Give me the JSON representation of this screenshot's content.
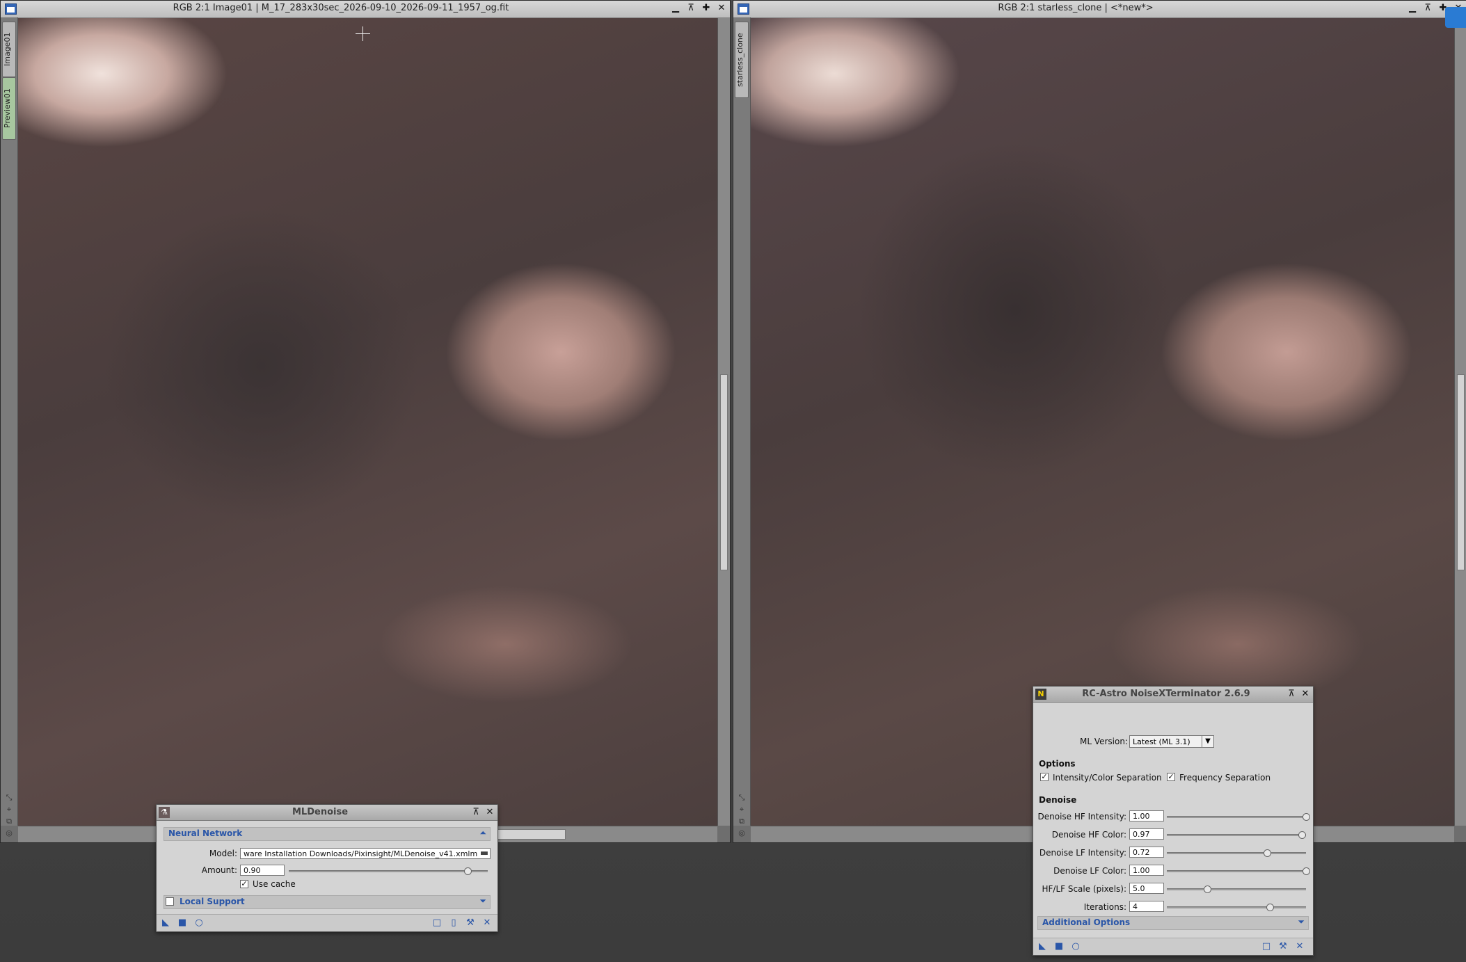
{
  "left_window": {
    "title": "RGB 2:1 Image01 | M_17_283x30sec_2026-09-10_2026-09-11_1957_og.fit",
    "tabs": [
      "Image01",
      "Preview01"
    ]
  },
  "right_window": {
    "title": "RGB 2:1 starless_clone | <*new*>",
    "tabs": [
      "starless_clone"
    ]
  },
  "mldenoise": {
    "title": "MLDenoise",
    "section_neural": "Neural Network",
    "model_label": "Model:",
    "model_value": "ware Installation Downloads/Pixinsight/MLDenoise_v41.xmlm",
    "amount_label": "Amount:",
    "amount_value": "0.90",
    "amount_fraction": 0.9,
    "use_cache_label": "Use cache",
    "use_cache_checked": true,
    "section_local": "Local Support",
    "local_support_checked": false
  },
  "nxt": {
    "title": "RC-Astro NoiseXTerminator 2.6.9",
    "icon_letter": "N",
    "ml_version_label": "ML Version:",
    "ml_version_value": "Latest (ML 3.1)",
    "options_heading": "Options",
    "intensity_sep_label": "Intensity/Color Separation",
    "intensity_sep_checked": true,
    "freq_sep_label": "Frequency Separation",
    "freq_sep_checked": true,
    "denoise_heading": "Denoise",
    "params": [
      {
        "label": "Denoise HF Intensity:",
        "value": "1.00",
        "fraction": 1.0
      },
      {
        "label": "Denoise HF Color:",
        "value": "0.97",
        "fraction": 0.97
      },
      {
        "label": "Denoise LF Intensity:",
        "value": "0.72",
        "fraction": 0.72
      },
      {
        "label": "Denoise LF Color:",
        "value": "1.00",
        "fraction": 1.0
      },
      {
        "label": "HF/LF Scale (pixels):",
        "value": "5.0",
        "fraction": 0.29
      },
      {
        "label": "Iterations:",
        "value": "4",
        "fraction": 0.74
      }
    ],
    "additional_options": "Additional Options"
  },
  "colors": {
    "accent": "#2a56a8",
    "window_bg": "#d4d4d4"
  }
}
